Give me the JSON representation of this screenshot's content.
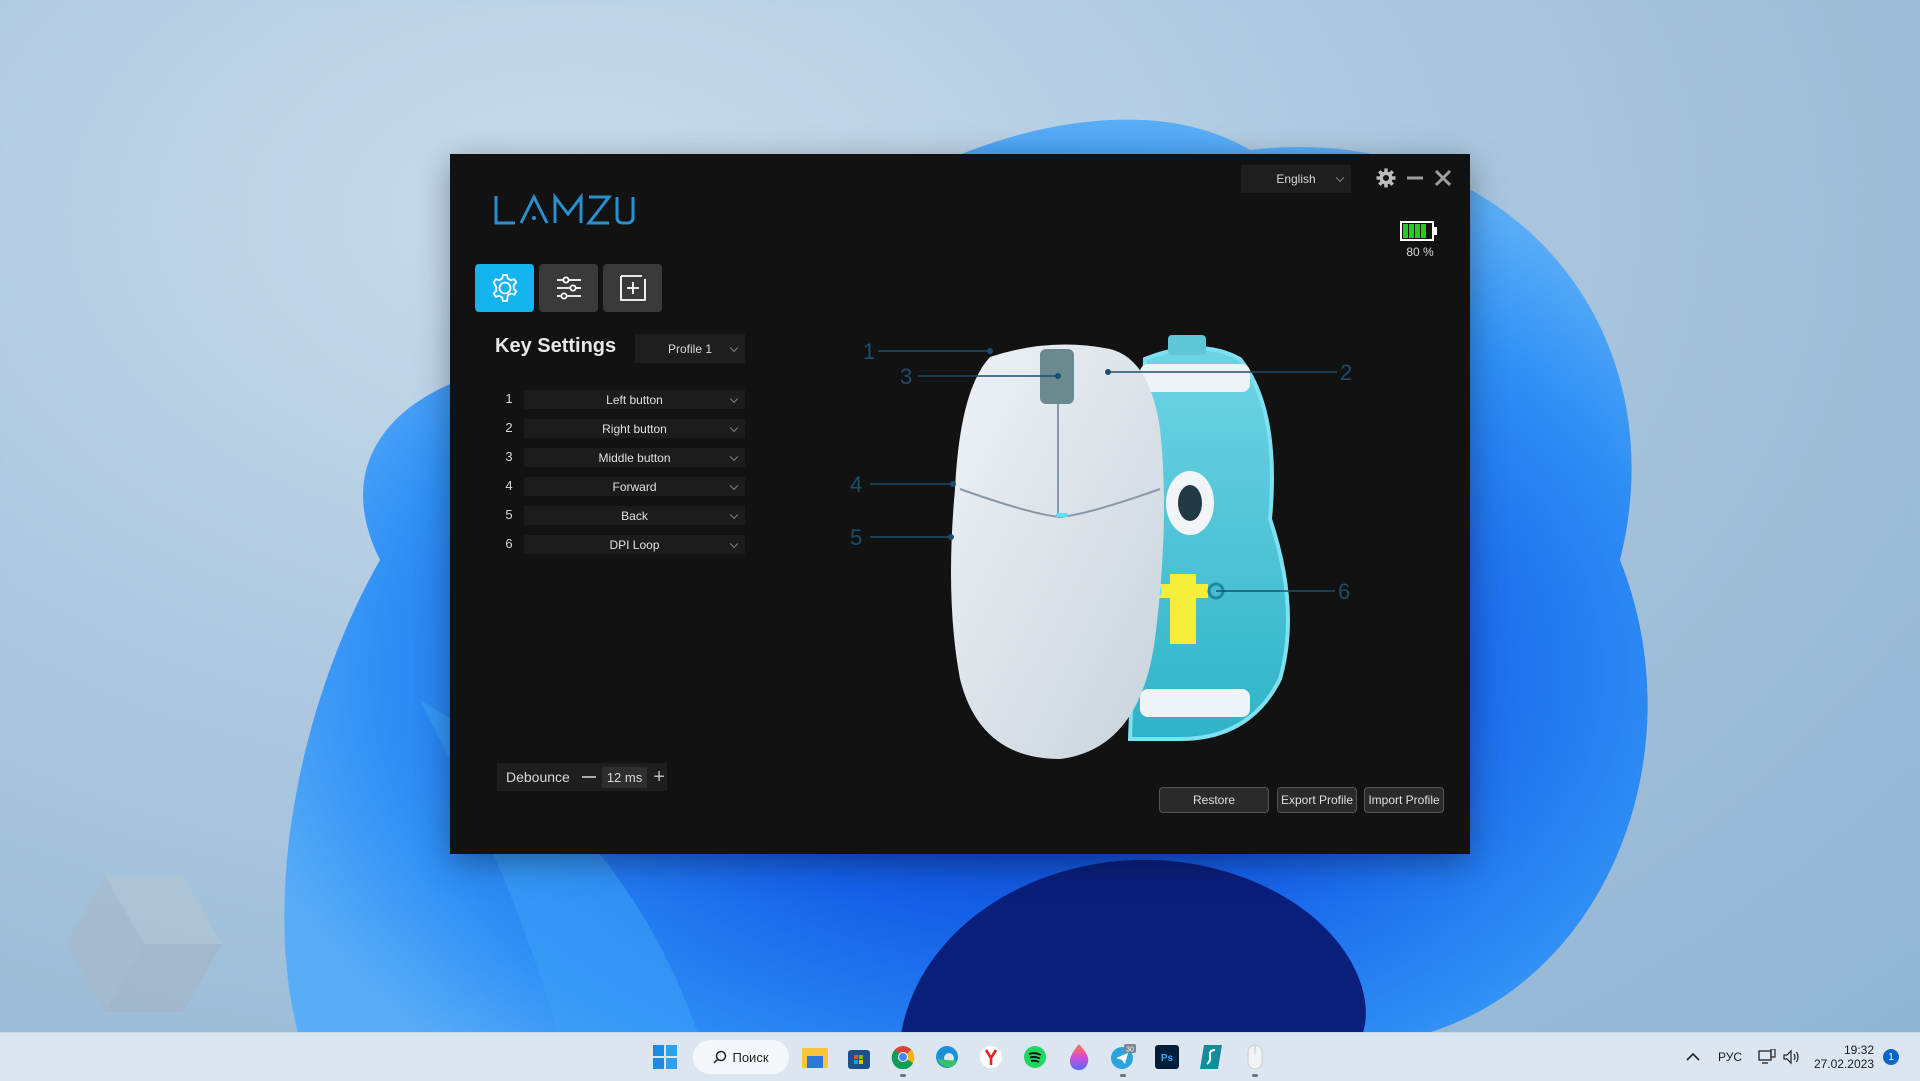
{
  "app": {
    "brand": "LAMZU",
    "accent_color": "#14b4f0",
    "language": {
      "selected": "English"
    },
    "window_controls": [
      "settings-icon",
      "minimize-icon",
      "close-icon"
    ],
    "battery": {
      "level_percent": 80,
      "label": "80 %",
      "color": "#22cc22"
    },
    "tabs": [
      {
        "name": "key-settings",
        "icon": "gear-icon",
        "active": true
      },
      {
        "name": "performance",
        "icon": "sliders-icon",
        "active": false
      },
      {
        "name": "macro",
        "icon": "plus-square-icon",
        "active": false
      }
    ],
    "key_settings": {
      "title": "Key Settings",
      "profile": {
        "selected": "Profile 1"
      },
      "rows": [
        {
          "num": "1",
          "value": "Left button"
        },
        {
          "num": "2",
          "value": "Right button"
        },
        {
          "num": "3",
          "value": "Middle button"
        },
        {
          "num": "4",
          "value": "Forward"
        },
        {
          "num": "5",
          "value": "Back"
        },
        {
          "num": "6",
          "value": "DPI Loop"
        }
      ]
    },
    "mouse_callouts": [
      "1",
      "2",
      "3",
      "4",
      "5",
      "6"
    ],
    "debounce": {
      "label": "Debounce",
      "value": "12 ms"
    },
    "buttons": {
      "restore": "Restore",
      "export": "Export Profile",
      "import": "Import Profile"
    }
  },
  "taskbar": {
    "search_label": "Поиск",
    "apps": [
      "start-icon",
      "file-explorer-icon",
      "store-icon",
      "chrome-icon",
      "edge-icon",
      "yandex-browser-icon",
      "spotify-icon",
      "firefox-nightly-icon",
      "telegram-icon",
      "photoshop-icon",
      "surfshark-icon",
      "mouse-app-icon"
    ],
    "telegram_badge": "30",
    "tray": {
      "language": "РУС",
      "time": "19:32",
      "date": "27.02.2023",
      "notifications": "1"
    }
  }
}
